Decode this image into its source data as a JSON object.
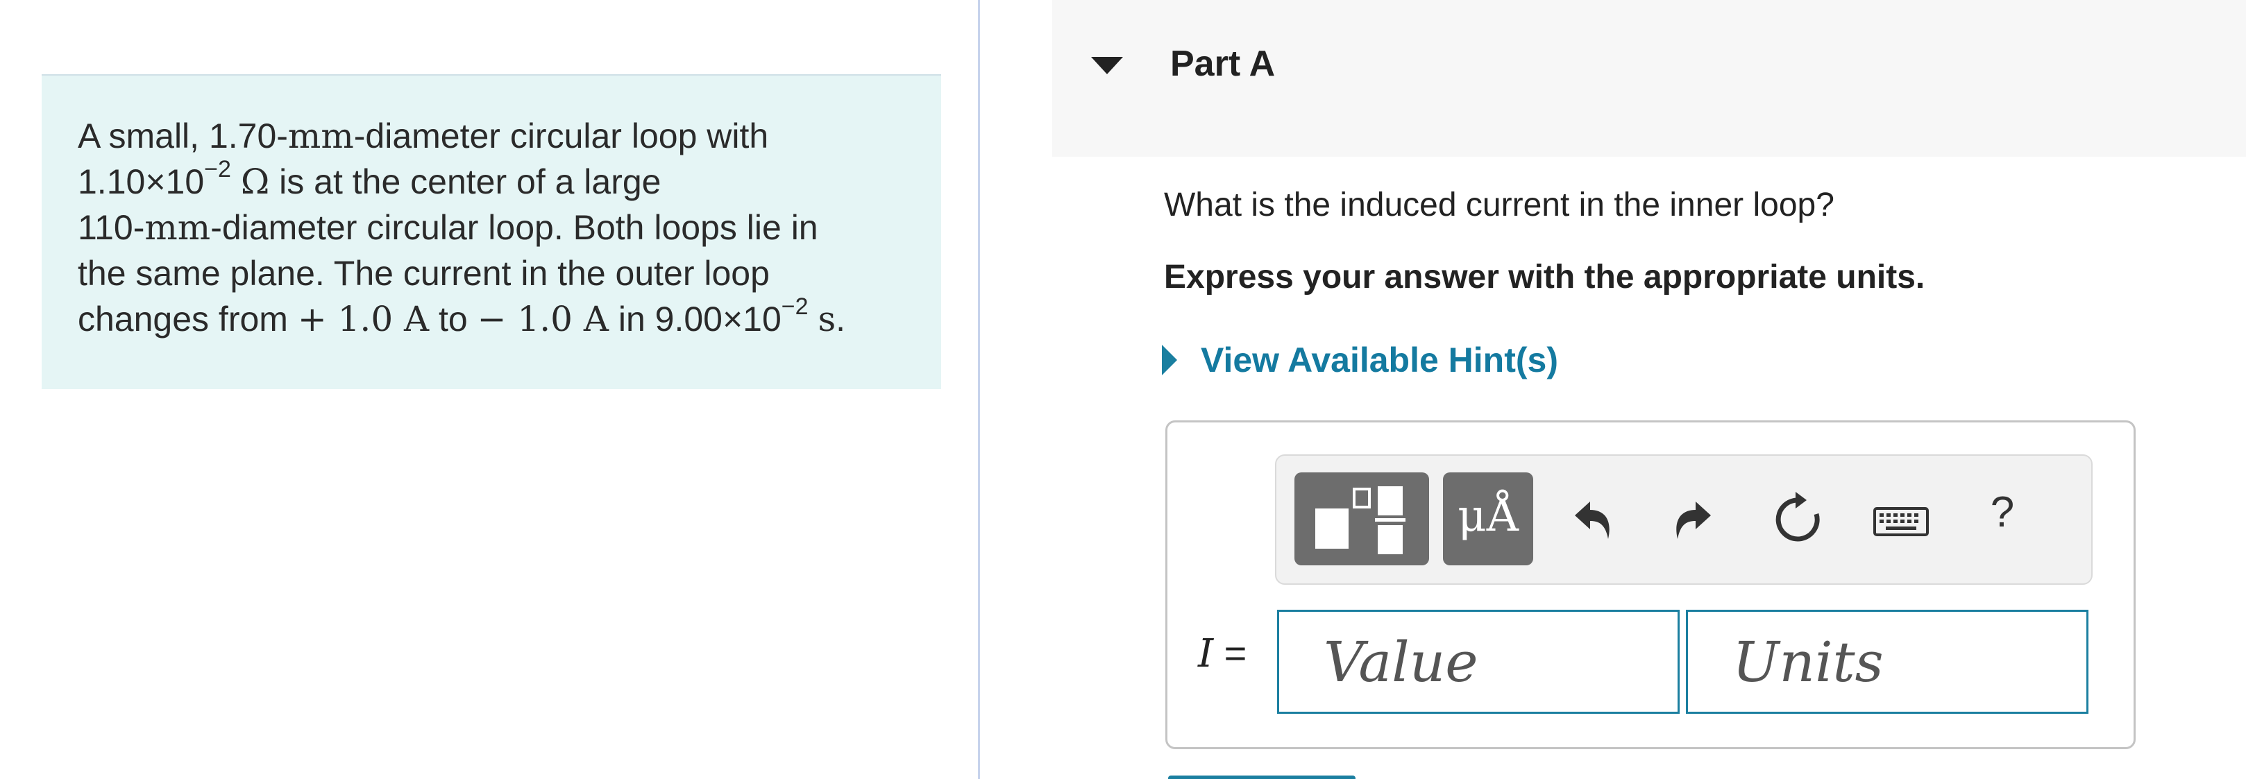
{
  "problem": {
    "line1_a": "A small, ",
    "line1_num": "1.70-",
    "line1_unit": "mm",
    "line1_b": "-diameter circular loop with",
    "line2_num": "1.10×10",
    "line2_exp": "−2",
    "line2_unit": "Ω",
    "line2_b": " is at the center of a large",
    "line3_num": "110-",
    "line3_unit": "mm",
    "line3_b": "-diameter circular loop. Both loops lie in",
    "line4": "the same plane. The current in the outer loop",
    "line5_a": "changes from ",
    "line5_from": "+ 1.0 A",
    "line5_to_word": " to ",
    "line5_to": "− 1.0 A",
    "line5_in": " in ",
    "line5_num": "9.00×10",
    "line5_exp": "−2",
    "line5_unit": "s",
    "line5_end": "."
  },
  "part": {
    "title": "Part A",
    "question": "What is the induced current in the inner loop?",
    "instruction": "Express your answer with the appropriate units.",
    "hint_label": "View Available Hint(s)"
  },
  "toolbar": {
    "units_label": "μÅ",
    "help_label": "?",
    "icons": [
      "templates-icon",
      "units-icon",
      "undo-icon",
      "redo-icon",
      "reset-icon",
      "keyboard-icon",
      "help-icon"
    ]
  },
  "answer": {
    "variable": "I",
    "equals": " =",
    "value_placeholder": "Value",
    "units_placeholder": "Units"
  },
  "colors": {
    "accent": "#147aa0",
    "problem_bg": "#e5f5f5",
    "toolbar_button": "#6d6d6d"
  }
}
